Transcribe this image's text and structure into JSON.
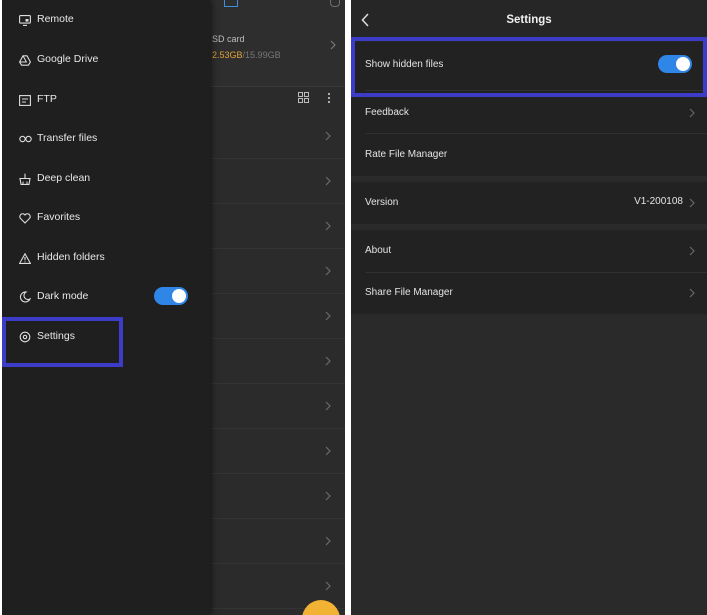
{
  "drawer": {
    "items": [
      {
        "label": "Remote",
        "icon": "remote-icon"
      },
      {
        "label": "Google Drive",
        "icon": "google-drive-icon"
      },
      {
        "label": "FTP",
        "icon": "ftp-icon"
      },
      {
        "label": "Transfer files",
        "icon": "transfer-icon"
      },
      {
        "label": "Deep clean",
        "icon": "deep-clean-icon"
      },
      {
        "label": "Favorites",
        "icon": "heart-icon"
      },
      {
        "label": "Hidden folders",
        "icon": "warning-icon"
      },
      {
        "label": "Dark mode",
        "icon": "moon-icon"
      },
      {
        "label": "Settings",
        "icon": "gear-icon"
      }
    ],
    "dark_mode_on": true
  },
  "storage": {
    "label": "SD card",
    "used": "2.53GB",
    "separator": "/",
    "total": "15.99GB"
  },
  "settings": {
    "title": "Settings",
    "show_hidden_files": "Show hidden files",
    "show_hidden_on": true,
    "feedback": "Feedback",
    "rate": "Rate File Manager",
    "version_label": "Version",
    "version_value": "V1-200108",
    "about": "About",
    "share": "Share File Manager"
  },
  "colors": {
    "accent": "#2f86e6",
    "highlight": "#3c3cc8",
    "storage_used": "#e0a23a",
    "fab": "#f2b233"
  }
}
